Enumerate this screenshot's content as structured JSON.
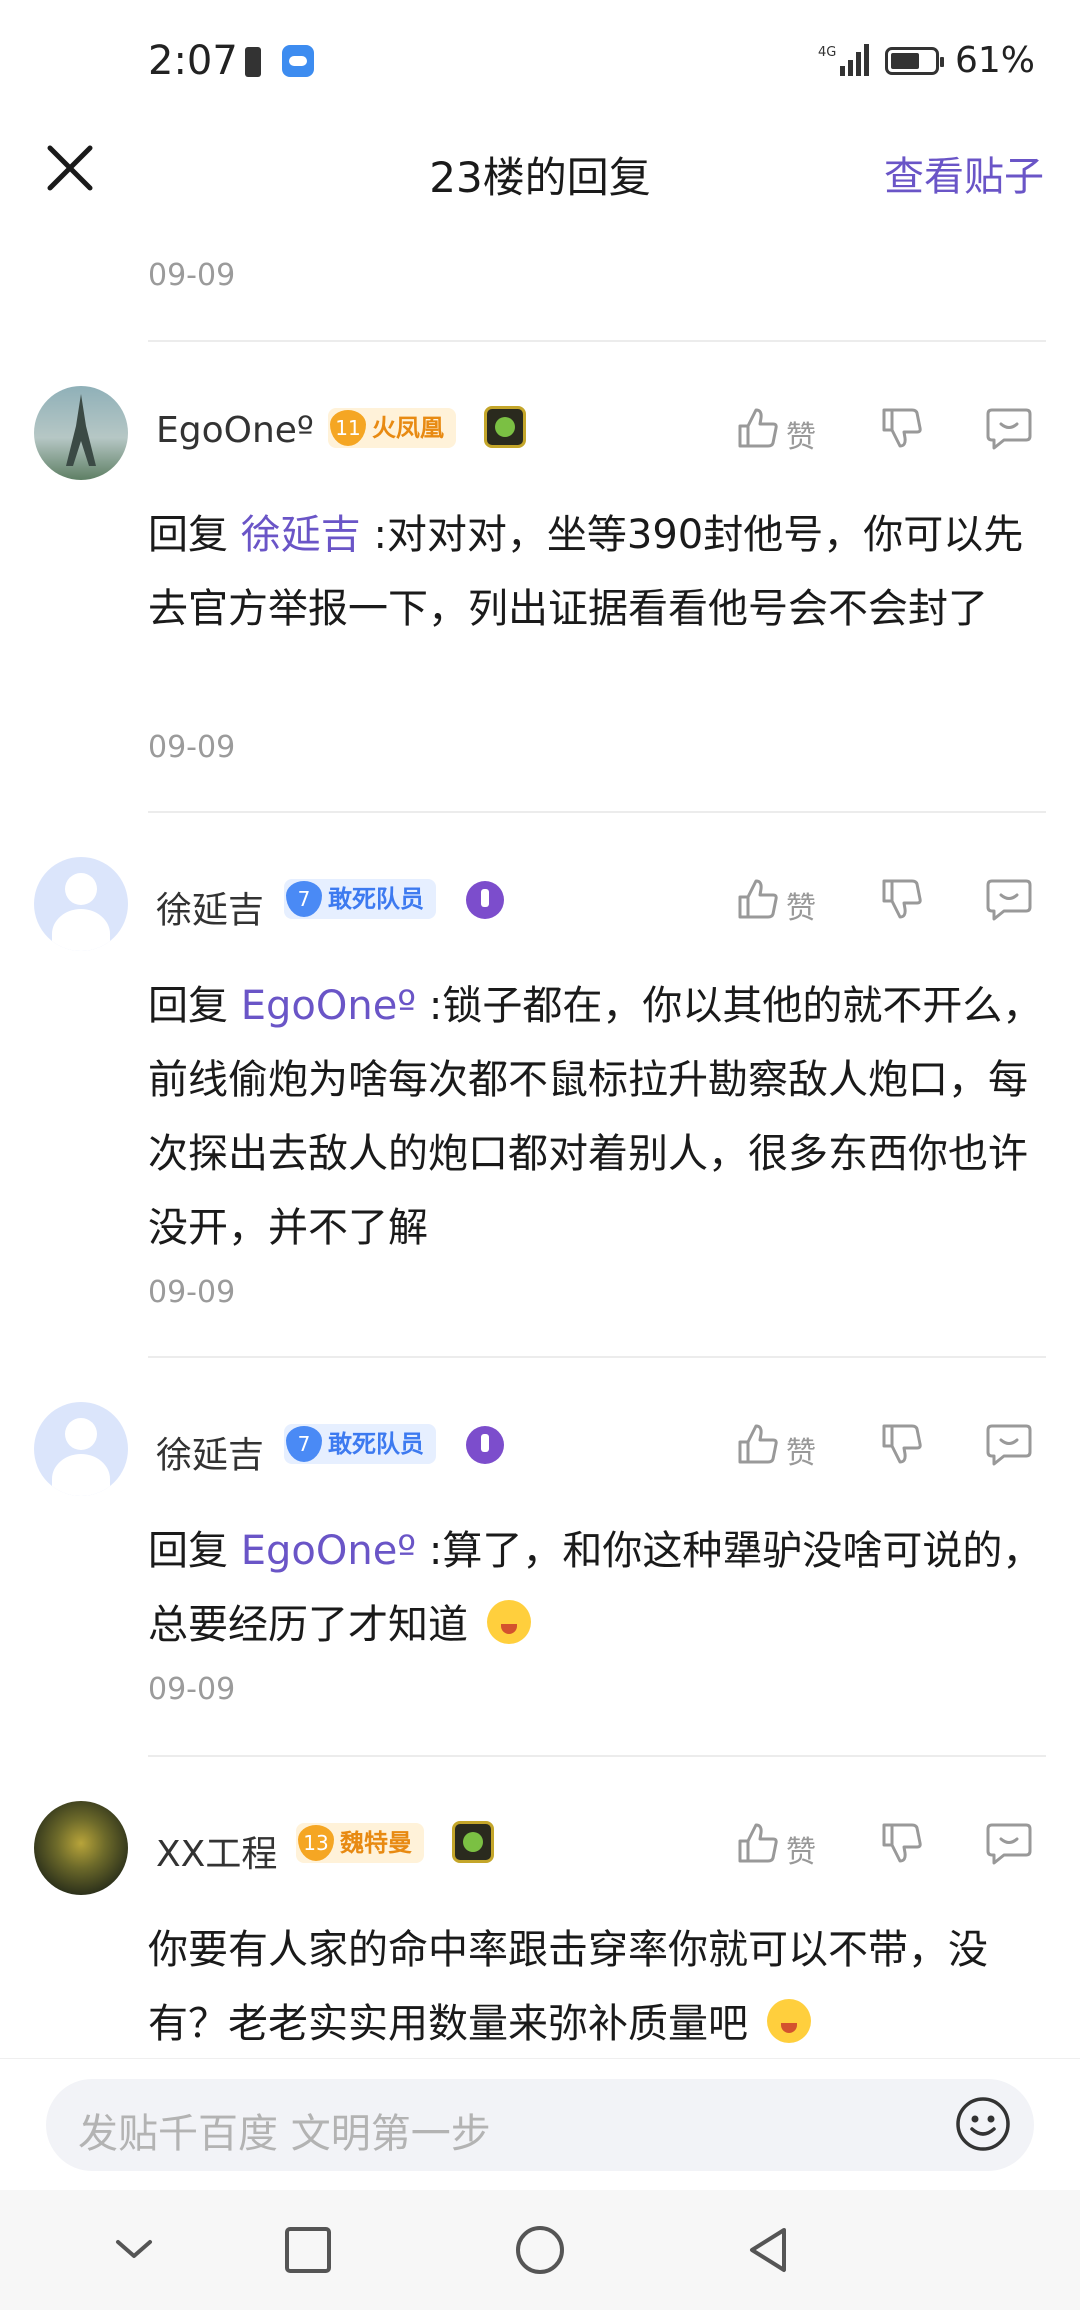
{
  "status_bar": {
    "time": "2:07",
    "network": "4G",
    "battery_pct": "61%"
  },
  "header": {
    "title": "23楼的回复",
    "view_post": "查看贴子"
  },
  "top_date": "09-09",
  "comments": [
    {
      "username": "EgoOneº",
      "badge_level": "11",
      "badge_text": "火凤凰",
      "like_label": "赞",
      "reply_prefix": "回复",
      "mention": "徐延吉",
      "text": ":对对对，坐等390封他号，你可以先去官方举报一下，列出证据看看他号会不会封了",
      "date": "09-09"
    },
    {
      "username": "徐延吉",
      "badge_level": "7",
      "badge_text": "敢死队员",
      "like_label": "赞",
      "reply_prefix": "回复",
      "mention": "EgoOneº",
      "text": ":锁子都在，你以其他的就不开么，前线偷炮为啥每次都不鼠标拉升勘察敌人炮口，每次探出去敌人的炮口都对着别人，很多东西你也许没开，并不了解",
      "date": "09-09"
    },
    {
      "username": "徐延吉",
      "badge_level": "7",
      "badge_text": "敢死队员",
      "like_label": "赞",
      "reply_prefix": "回复",
      "mention": "EgoOneº",
      "text": ":算了，和你这种犟驴没啥可说的，总要经历了才知道",
      "date": "09-09"
    },
    {
      "username": "XX工程",
      "badge_level": "13",
      "badge_text": "魏特曼",
      "like_label": "赞",
      "text": "你要有人家的命中率跟击穿率你就可以不带，没有？老老实实用数量来弥补质量吧"
    }
  ],
  "input": {
    "placeholder": "发贴千百度 文明第一步"
  },
  "colors": {
    "accent": "#6a55c7",
    "gold_badge": "#f5a623",
    "blue_badge": "#4a8af5"
  },
  "icons": [
    "close-icon",
    "thumbs-up-icon",
    "thumbs-down-icon",
    "reply-bubble-icon",
    "emoji-icon",
    "nav-back-icon",
    "nav-home-icon",
    "nav-recents-icon",
    "nav-collapse-icon"
  ]
}
